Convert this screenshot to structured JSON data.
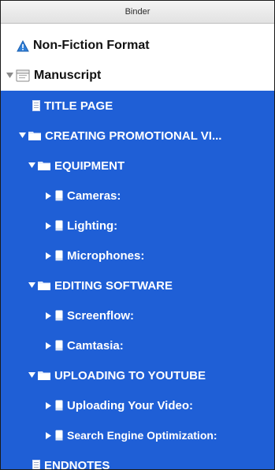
{
  "header": {
    "title": "Binder"
  },
  "tree": {
    "project_label": "Non-Fiction Format",
    "manuscript_label": "Manuscript",
    "title_page": "TITLE PAGE",
    "chapter": "CREATING PROMOTIONAL VI...",
    "equipment": "EQUIPMENT",
    "cameras": "Cameras:",
    "lighting": "Lighting:",
    "microphones": "Microphones:",
    "editing_software": "EDITING SOFTWARE",
    "screenflow": "Screenflow:",
    "camtasia": "Camtasia:",
    "uploading": "UPLOADING TO YOUTUBE",
    "uploading_video": "Uploading Your Video:",
    "seo": "Search Engine Optimization:",
    "endnotes": "ENDNOTES"
  },
  "colors": {
    "selection": "#1f5fd6",
    "warning": "#2f7fd8"
  },
  "icons": {
    "project": "warning-icon",
    "manuscript": "manuscript-icon",
    "folder": "folder-icon",
    "document": "document-icon",
    "expanded": "disclosure-down-icon",
    "collapsed": "disclosure-right-icon"
  }
}
